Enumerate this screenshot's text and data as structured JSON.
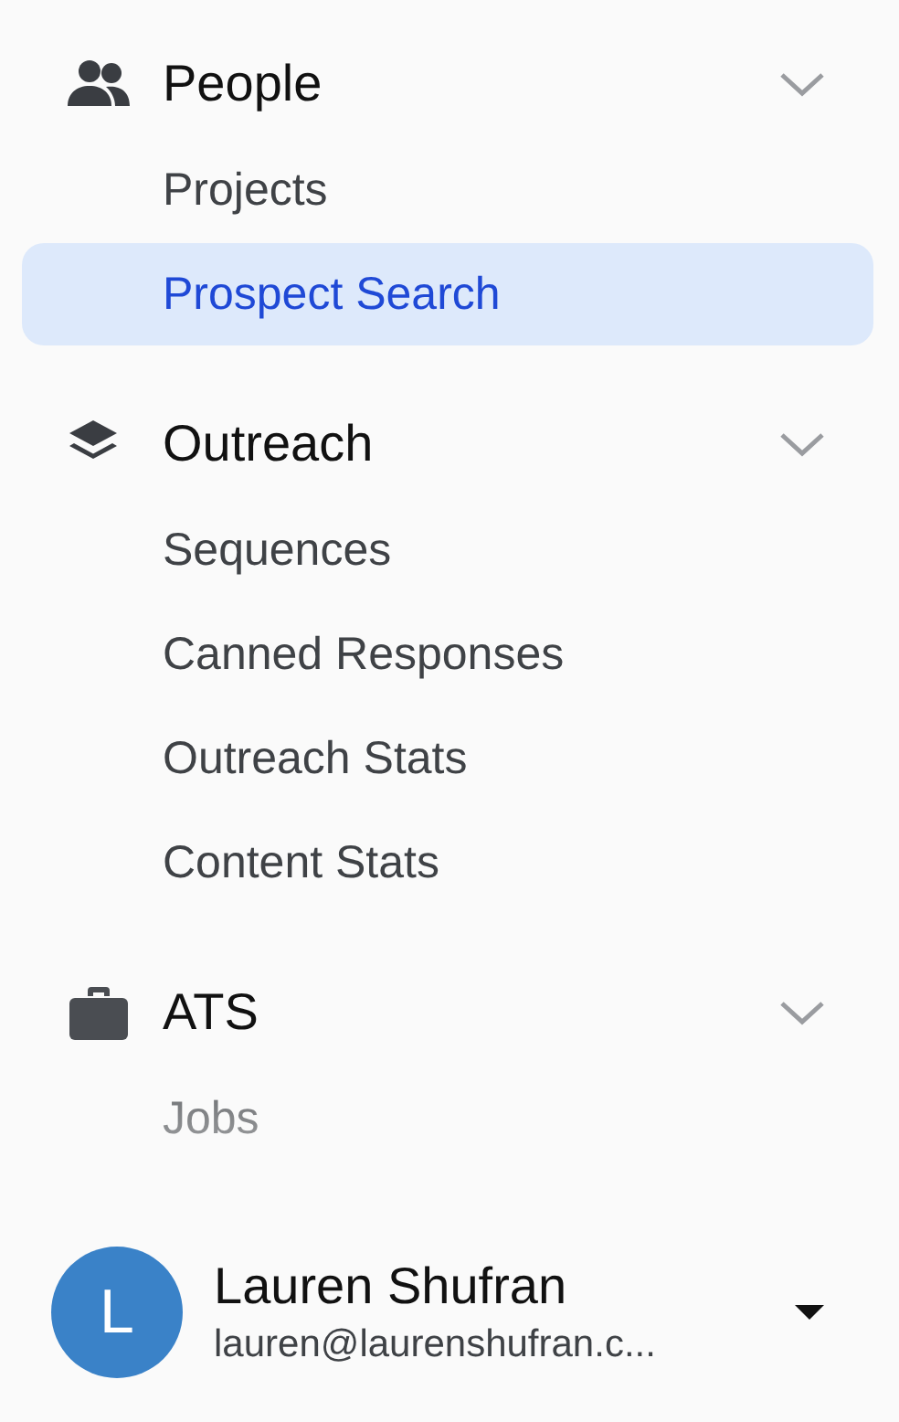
{
  "sections": [
    {
      "kind": "people",
      "title": "People",
      "expanded": true,
      "items": [
        {
          "label": "Projects",
          "selected": false
        },
        {
          "label": "Prospect Search",
          "selected": true
        }
      ]
    },
    {
      "kind": "layers",
      "title": "Outreach",
      "expanded": true,
      "items": [
        {
          "label": "Sequences",
          "selected": false
        },
        {
          "label": "Canned Responses",
          "selected": false
        },
        {
          "label": "Outreach Stats",
          "selected": false
        },
        {
          "label": "Content Stats",
          "selected": false
        }
      ]
    },
    {
      "kind": "briefcase",
      "title": "ATS",
      "expanded": true,
      "items": [
        {
          "label": "Jobs",
          "selected": false
        }
      ]
    }
  ],
  "user": {
    "initial": "L",
    "name": "Lauren Shufran",
    "email": "lauren@laurenshufran.c..."
  }
}
